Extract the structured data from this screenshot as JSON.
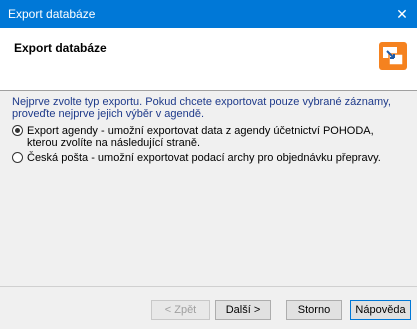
{
  "window": {
    "title": "Export databáze",
    "close_glyph": "✕"
  },
  "header": {
    "title": "Export databáze",
    "icon": "export-database-icon"
  },
  "content": {
    "intro": "Nejprve zvolte typ exportu. Pokud chcete exportovat pouze vybrané záznamy, proveďte nejprve jejich výběr v agendě.",
    "options": [
      {
        "label": "Export agendy  - umožní exportovat data z agendy účetnictví POHODA, kterou zvolíte na následující straně.",
        "checked": true
      },
      {
        "label": "Česká pošta - umožní exportovat podací archy pro objednávku přepravy.",
        "checked": false
      }
    ]
  },
  "buttons": {
    "back": "< Zpět",
    "next": "Další >",
    "cancel": "Storno",
    "help": "Nápověda"
  },
  "colors": {
    "titlebar": "#0078d7",
    "intro_text": "#1e3a8a"
  }
}
